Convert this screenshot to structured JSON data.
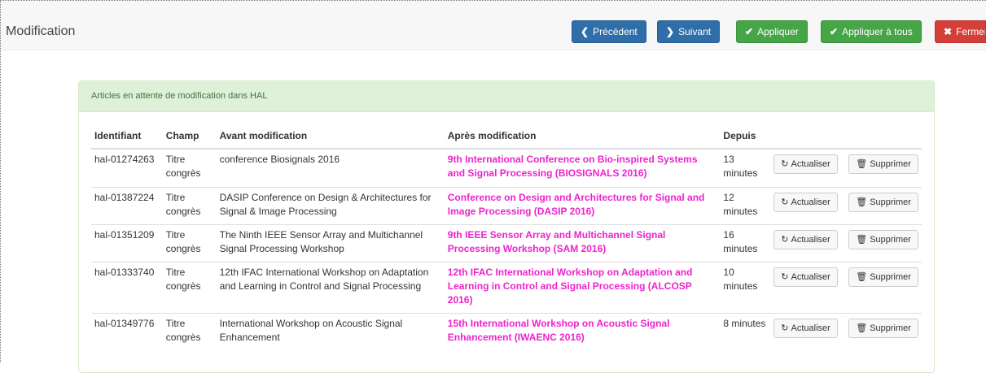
{
  "header": {
    "title": "Modification",
    "buttons": {
      "previous": {
        "icon": "chevron-left-icon",
        "glyph": "❮",
        "label": "Précédent"
      },
      "next": {
        "icon": "chevron-right-icon",
        "glyph": "❯",
        "label": "Suivant"
      },
      "apply": {
        "icon": "check-icon",
        "glyph": "✔",
        "label": "Appliquer"
      },
      "apply_all": {
        "icon": "check-icon",
        "glyph": "✔",
        "label": "Appliquer à tous"
      },
      "close": {
        "icon": "close-icon",
        "glyph": "✖",
        "label": "Fermer"
      }
    }
  },
  "panel": {
    "heading": "Articles en attente de modification dans HAL",
    "columns": [
      "Identifiant",
      "Champ",
      "Avant modification",
      "Après modification",
      "Depuis",
      "",
      ""
    ],
    "refresh_label": "Actualiser",
    "refresh_glyph": "↻",
    "delete_label": "Supprimer",
    "delete_glyph": "🗑",
    "rows": [
      {
        "id": "hal-01274263",
        "field": "Titre congrès",
        "before": "conference Biosignals 2016",
        "after": "9th International Conference on Bio-inspired Systems and Signal Processing (BIOSIGNALS 2016)",
        "since": "13 minutes"
      },
      {
        "id": "hal-01387224",
        "field": "Titre congrès",
        "before": "DASIP Conference on Design & Architectures for Signal & Image Processing",
        "after": "Conference on Design and Architectures for Signal and Image Processing (DASIP 2016)",
        "since": "12 minutes"
      },
      {
        "id": "hal-01351209",
        "field": "Titre congrès",
        "before": "The Ninth IEEE Sensor Array and Multichannel Signal Processing Workshop",
        "after": "9th IEEE Sensor Array and Multichannel Signal Processing Workshop (SAM 2016)",
        "since": "16 minutes"
      },
      {
        "id": "hal-01333740",
        "field": "Titre congrès",
        "before": "12th IFAC International Workshop on Adaptation and Learning in Control and Signal Processing",
        "after": "12th IFAC International Workshop on Adaptation and Learning in Control and Signal Processing (ALCOSP 2016)",
        "since": "10 minutes"
      },
      {
        "id": "hal-01349776",
        "field": "Titre congrès",
        "before": "International Workshop on Acoustic Signal Enhancement",
        "after": "15th International Workshop on Acoustic Signal Enhancement (IWAENC 2016)",
        "since": "8 minutes"
      }
    ]
  },
  "colors": {
    "primary": "#2f6ea9",
    "success": "#46a546",
    "danger": "#d43f3a",
    "highlight": "#ee22cc",
    "panel_heading_bg": "#dff0d8"
  }
}
